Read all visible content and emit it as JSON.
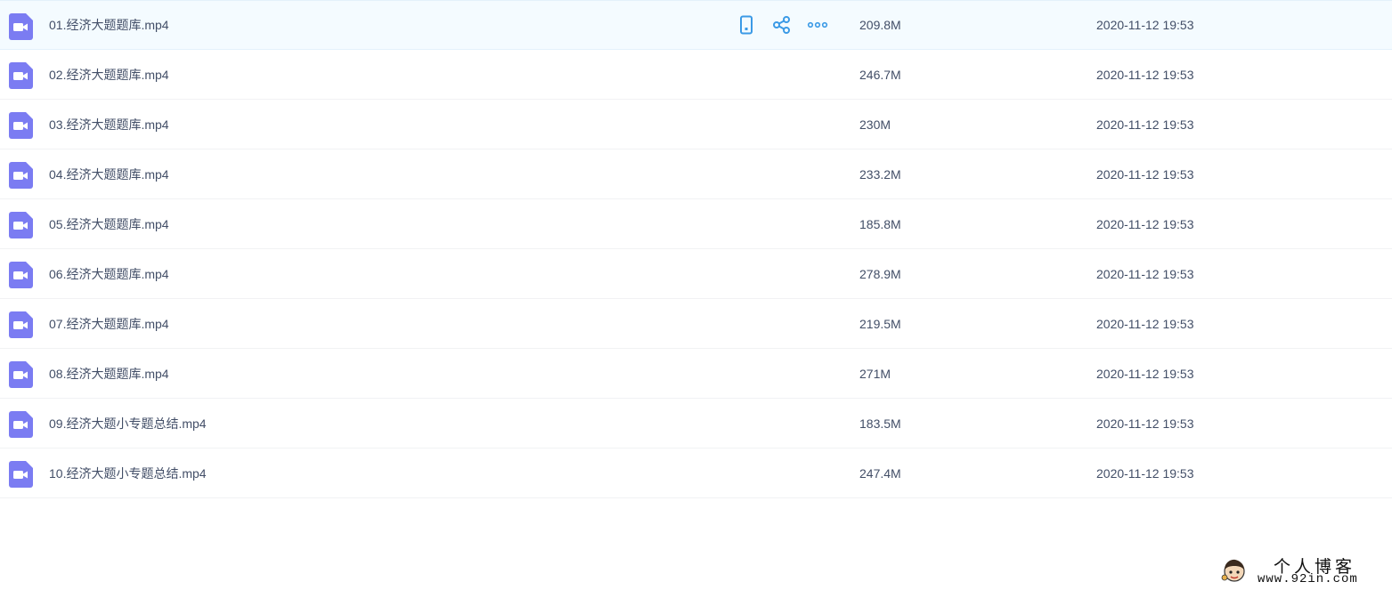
{
  "files": [
    {
      "name": "01.经济大题题库.mp4",
      "size": "209.8M",
      "date": "2020-11-12 19:53",
      "icon": "video-file-icon"
    },
    {
      "name": "02.经济大题题库.mp4",
      "size": "246.7M",
      "date": "2020-11-12 19:53",
      "icon": "video-file-icon"
    },
    {
      "name": "03.经济大题题库.mp4",
      "size": "230M",
      "date": "2020-11-12 19:53",
      "icon": "video-file-icon"
    },
    {
      "name": "04.经济大题题库.mp4",
      "size": "233.2M",
      "date": "2020-11-12 19:53",
      "icon": "video-file-icon"
    },
    {
      "name": "05.经济大题题库.mp4",
      "size": "185.8M",
      "date": "2020-11-12 19:53",
      "icon": "video-file-icon"
    },
    {
      "name": "06.经济大题题库.mp4",
      "size": "278.9M",
      "date": "2020-11-12 19:53",
      "icon": "video-file-icon"
    },
    {
      "name": "07.经济大题题库.mp4",
      "size": "219.5M",
      "date": "2020-11-12 19:53",
      "icon": "video-file-icon"
    },
    {
      "name": "08.经济大题题库.mp4",
      "size": "271M",
      "date": "2020-11-12 19:53",
      "icon": "video-file-icon"
    },
    {
      "name": "09.经济大题小专题总结.mp4",
      "size": "183.5M",
      "date": "2020-11-12 19:53",
      "icon": "video-file-icon"
    },
    {
      "name": "10.经济大题小专题总结.mp4",
      "size": "247.4M",
      "date": "2020-11-12 19:53",
      "icon": "video-file-icon"
    }
  ],
  "hover_row_actions": [
    {
      "icon": "phone-icon"
    },
    {
      "icon": "share-icon"
    },
    {
      "icon": "more-icon"
    }
  ],
  "watermark": {
    "title": "个人博客",
    "url": "www.92in.com"
  },
  "colors": {
    "text": "#424e67",
    "video_icon": "#7b7cf2",
    "action_icon": "#3b9ae6",
    "hover_row": "#f4fbff"
  }
}
